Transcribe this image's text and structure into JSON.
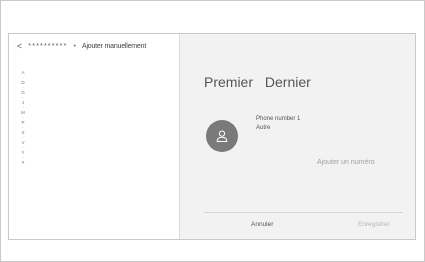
{
  "header": {
    "back_glyph": "<",
    "masked_name": "**********",
    "separator": "•",
    "add_manually": "Ajouter manuellement"
  },
  "alpha_index": [
    "A",
    "·",
    "D",
    "·",
    "G",
    "·",
    "J",
    "·",
    "M",
    "·",
    "P",
    "·",
    "S",
    "·",
    "V",
    "·",
    "Y",
    "·",
    "#"
  ],
  "contact": {
    "first_name": "Premier",
    "last_name": "Dernier",
    "phone_label": "Phone number 1",
    "phone_type": "Autre",
    "add_number": "Ajouter un numéro"
  },
  "actions": {
    "cancel": "Annuler",
    "save": "Enregistrer"
  },
  "colors": {
    "avatar_bg": "#7a7a7a",
    "right_pane_bg": "#f2f2f2",
    "disabled_text": "#b4b4b4"
  },
  "icons": {
    "avatar": "person-icon",
    "back": "chevron-left-icon"
  }
}
